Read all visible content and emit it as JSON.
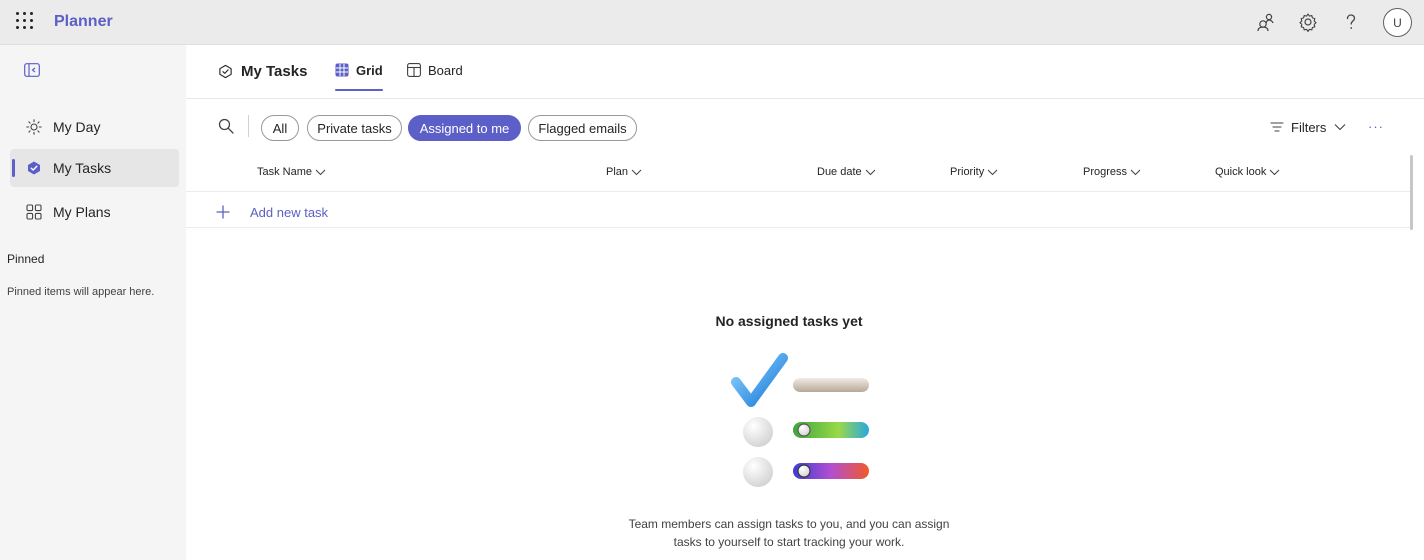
{
  "app": {
    "name": "Planner",
    "avatar_initial": "U"
  },
  "topbar": {
    "icons": [
      "people-icon",
      "gear-icon",
      "help-icon"
    ]
  },
  "sidebar": {
    "items": [
      {
        "label": "My Day",
        "icon": "sun-icon",
        "active": false
      },
      {
        "label": "My Tasks",
        "icon": "tasks-icon",
        "active": true
      },
      {
        "label": "My Plans",
        "icon": "grid-icon",
        "active": false
      }
    ],
    "pinned_title": "Pinned",
    "pinned_empty": "Pinned items will appear here."
  },
  "header": {
    "title": "My Tasks",
    "tabs": [
      {
        "label": "Grid",
        "active": true
      },
      {
        "label": "Board",
        "active": false
      }
    ]
  },
  "filters": {
    "pills": [
      {
        "label": "All",
        "selected": false
      },
      {
        "label": "Private tasks",
        "selected": false
      },
      {
        "label": "Assigned to me",
        "selected": true
      },
      {
        "label": "Flagged emails",
        "selected": false
      }
    ],
    "filters_label": "Filters",
    "more_label": "···"
  },
  "table": {
    "columns": [
      "Task Name",
      "Plan",
      "Due date",
      "Priority",
      "Progress",
      "Quick look"
    ],
    "add_task_label": "Add new task"
  },
  "empty_state": {
    "title": "No assigned tasks yet",
    "description_line1": "Team members can assign tasks to you, and you can assign",
    "description_line2": "tasks to yourself to start tracking your work."
  },
  "colors": {
    "accent": "#5b5fc7",
    "topbar_bg": "#ebebeb",
    "sidebar_bg": "#f5f5f5"
  }
}
